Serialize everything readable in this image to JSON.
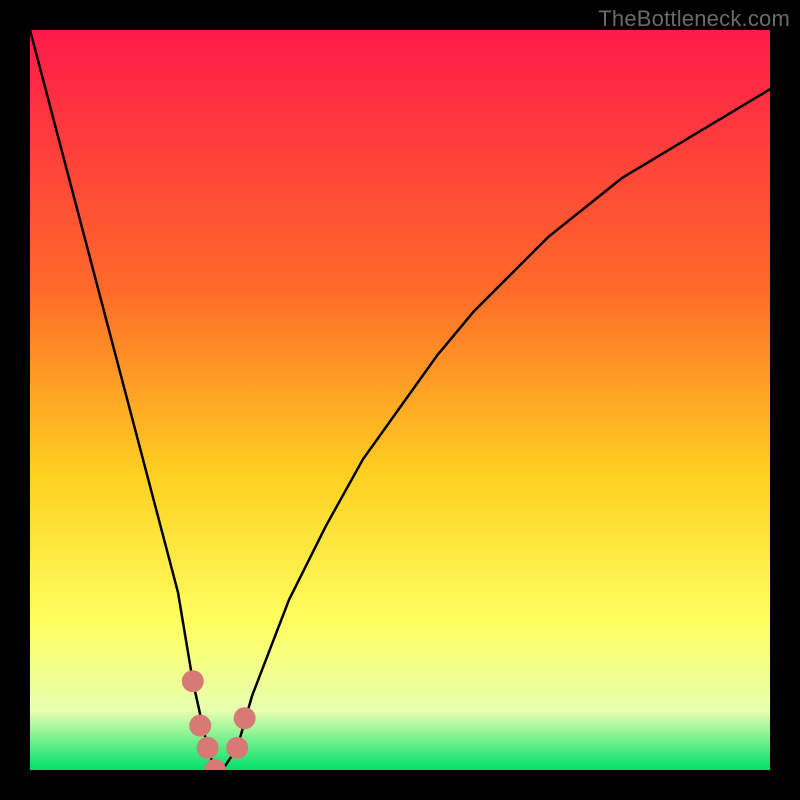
{
  "watermark": "TheBottleneck.com",
  "chart_data": {
    "type": "line",
    "title": "",
    "xlabel": "",
    "ylabel": "",
    "xlim": [
      0,
      100
    ],
    "ylim": [
      0,
      100
    ],
    "x": [
      0,
      5,
      10,
      15,
      20,
      22,
      24,
      25,
      26,
      28,
      30,
      35,
      40,
      45,
      50,
      55,
      60,
      65,
      70,
      75,
      80,
      85,
      90,
      95,
      100
    ],
    "values": [
      100,
      81,
      62,
      43,
      24,
      12,
      3,
      0,
      0,
      3,
      10,
      23,
      33,
      42,
      49,
      56,
      62,
      67,
      72,
      76,
      80,
      83,
      86,
      89,
      92
    ],
    "series": [
      {
        "name": "bottleneck-curve",
        "x": [
          0,
          5,
          10,
          15,
          20,
          22,
          24,
          25,
          26,
          28,
          30,
          35,
          40,
          45,
          50,
          55,
          60,
          65,
          70,
          75,
          80,
          85,
          90,
          95,
          100
        ],
        "y": [
          100,
          81,
          62,
          43,
          24,
          12,
          3,
          0,
          0,
          3,
          10,
          23,
          33,
          42,
          49,
          56,
          62,
          67,
          72,
          76,
          80,
          83,
          86,
          89,
          92
        ]
      }
    ],
    "highlight_points": [
      {
        "x": 22,
        "y": 12
      },
      {
        "x": 23,
        "y": 6
      },
      {
        "x": 24,
        "y": 3
      },
      {
        "x": 25,
        "y": 0
      },
      {
        "x": 28,
        "y": 3
      },
      {
        "x": 29,
        "y": 7
      }
    ],
    "background_gradient": {
      "top": "#ff1a4a",
      "mid1": "#ff6a2a",
      "mid2": "#ffd020",
      "mid3": "#ffff60",
      "mid4": "#e8ffb0",
      "bottom": "#00e06a"
    }
  }
}
